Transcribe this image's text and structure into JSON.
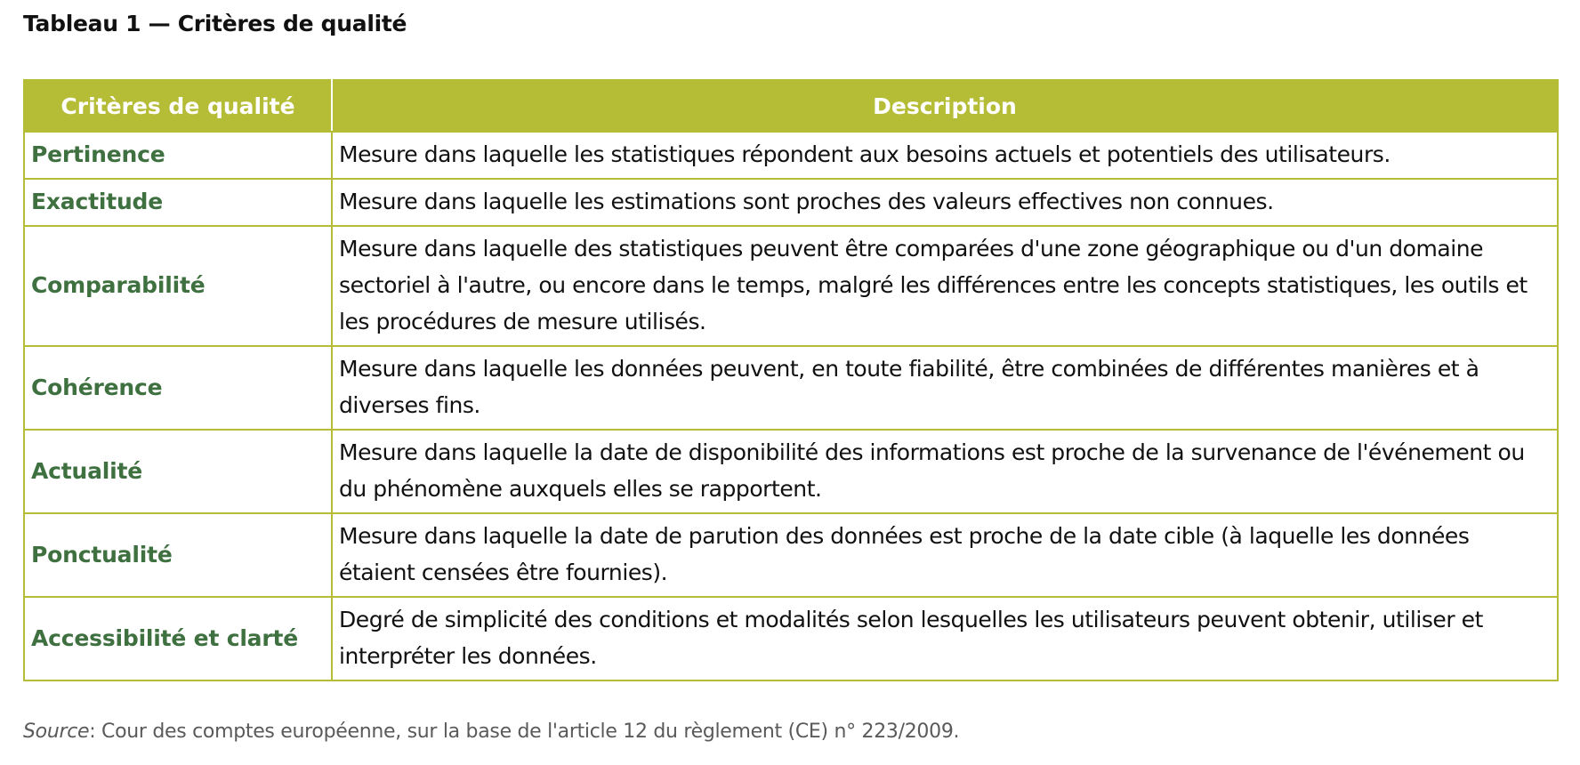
{
  "title": "Tableau 1 — Critères de qualité",
  "table": {
    "headers": [
      "Critères de qualité",
      "Description"
    ],
    "rows": [
      {
        "criterion": "Pertinence",
        "description": "Mesure dans laquelle les statistiques répondent aux besoins actuels et potentiels des utilisateurs."
      },
      {
        "criterion": "Exactitude",
        "description": "Mesure dans laquelle les estimations sont proches des valeurs effectives non connues."
      },
      {
        "criterion": "Comparabilité",
        "description": "Mesure dans laquelle des statistiques peuvent être comparées d'une zone géographique ou d'un domaine sectoriel à l'autre, ou encore dans le temps, malgré les différences entre les concepts statistiques, les outils et les procédures de mesure utilisés."
      },
      {
        "criterion": "Cohérence",
        "description": "Mesure dans laquelle les données peuvent, en toute fiabilité, être combinées de différentes manières et à diverses fins."
      },
      {
        "criterion": "Actualité",
        "description": "Mesure dans laquelle la date de disponibilité des informations est proche de la survenance de l'événement ou du phénomène auxquels elles se rapportent."
      },
      {
        "criterion": "Ponctualité",
        "description": "Mesure dans laquelle la date de parution des données est proche de la date cible (à laquelle les données étaient censées être fournies)."
      },
      {
        "criterion": "Accessibilité et clarté",
        "description": "Degré de simplicité des conditions et modalités selon lesquelles les utilisateurs peuvent obtenir, utiliser et interpréter les données."
      }
    ]
  },
  "source": {
    "label": "Source",
    "text": ": Cour des comptes européenne, sur la base de l'article 12 du règlement (CE) n° 223/2009."
  },
  "colors": {
    "header_background": "#b5bc36",
    "header_text": "#ffffff",
    "criterion_text": "#3e7040",
    "border": "#b5bc36",
    "source_text": "#5a5a5a"
  }
}
